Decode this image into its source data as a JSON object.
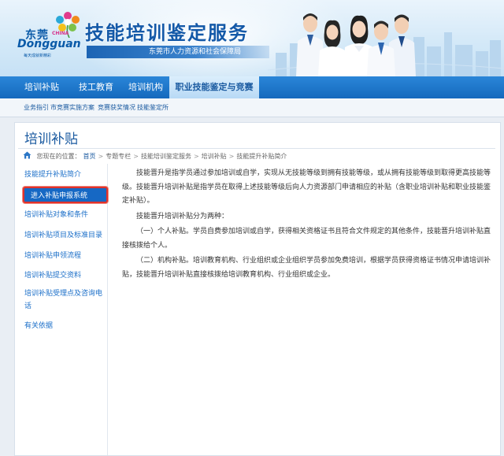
{
  "header": {
    "logo_cn": "东莞",
    "logo_en_small": "CHINA",
    "logo_en": "Dongguan",
    "logo_sub": "每天成就新精彩",
    "site_title": "技能培训鉴定服务",
    "site_subtitle": "东莞市人力资源和社会保障局"
  },
  "nav": {
    "items": [
      "培训补贴",
      "技工教育",
      "培训机构",
      "职业技能鉴定与竞赛"
    ],
    "active_index": 3
  },
  "subnav": {
    "items": [
      "业务指引",
      "市竞赛实施方案",
      "竞赛获奖情况",
      "技能鉴定所"
    ]
  },
  "page": {
    "title": "培训补贴",
    "breadcrumb_prefix": "您现在的位置：",
    "breadcrumb": [
      "首页",
      "专题专栏",
      "技能培训鉴定服务",
      "培训补贴",
      "技能提升补贴简介"
    ],
    "breadcrumb_sep": ">"
  },
  "sidebar": {
    "items": [
      "技能提升补贴简介",
      "进入补贴申报系统",
      "培训补贴对象和条件",
      "培训补贴项目及标准目录",
      "培训补贴申领流程",
      "培训补贴提交资料",
      "培训补贴受理点及咨询电话",
      "有关依据"
    ],
    "highlighted_index": 1
  },
  "article": {
    "paragraphs": [
      "技能晋升是指学员通过参加培训或自学，实现从无技能等级到拥有技能等级，或从拥有技能等级到取得更高技能等级。技能晋升培训补贴是指学员在取得上述技能等级后向人力资源部门申请相应的补贴（含职业培训补贴和职业技能鉴定补贴）。",
      "技能晋升培训补贴分为两种：",
      "（一）个人补贴。学员自费参加培训或自学，获得相关资格证书且符合文件规定的其他条件，技能晋升培训补贴直接核拨给个人。",
      "（二）机构补贴。培训教育机构、行业组织或企业组织学员参加免费培训，根据学员获得资格证书情况申请培训补贴，技能晋升培训补贴直接核拨给培训教育机构、行业组织或企业。"
    ]
  },
  "colors": {
    "nav_blue": "#1569bd",
    "link_blue": "#1a6ec8",
    "title_blue": "#1459a8",
    "highlight_border": "#e0322a"
  }
}
